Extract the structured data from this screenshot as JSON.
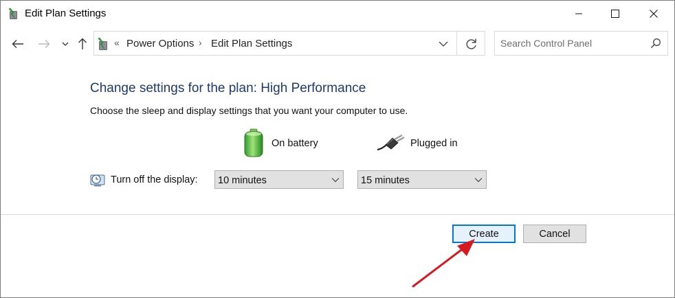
{
  "window": {
    "title": "Edit Plan Settings",
    "app_icon": "power-options-icon",
    "controls": [
      "minimize-icon",
      "maximize-icon",
      "close-icon"
    ]
  },
  "nav": {
    "back_icon": "back-arrow-icon",
    "forward_icon": "forward-arrow-icon",
    "recent_icon": "chevron-down-icon",
    "up_icon": "up-arrow-icon",
    "address": {
      "overflow": "«",
      "breadcrumbs": [
        "Power Options",
        "Edit Plan Settings"
      ],
      "separator": "›"
    },
    "refresh_icon": "refresh-icon",
    "search": {
      "placeholder": "Search Control Panel",
      "icon": "search-icon"
    }
  },
  "main": {
    "heading": "Change settings for the plan: High Performance",
    "subtitle": "Choose the sleep and display settings that you want your computer to use.",
    "columns": [
      {
        "label": "On battery",
        "icon": "battery-icon"
      },
      {
        "label": "Plugged in",
        "icon": "plug-icon"
      }
    ],
    "rows": [
      {
        "label": "Turn off the display:",
        "icon": "display-timeout-icon",
        "on_battery": "10 minutes",
        "plugged_in": "15 minutes"
      }
    ]
  },
  "buttons": {
    "create": "Create",
    "cancel": "Cancel"
  },
  "colors": {
    "heading": "#1e3a6e",
    "accent": "#0078d7",
    "annotation_arrow": "#d7191f"
  }
}
